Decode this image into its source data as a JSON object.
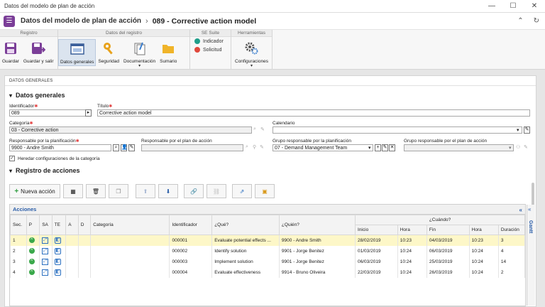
{
  "window": {
    "title": "Datos del modelo de plan de acción",
    "controls": [
      "—",
      "☐",
      "✕"
    ]
  },
  "header": {
    "app_title": "Datos del modelo de plan de acción",
    "separator": "›",
    "record": "089 - Corrective action model"
  },
  "ribbon": {
    "groups": [
      {
        "title": "Registro",
        "buttons": [
          "Guardar",
          "Guardar y salir"
        ]
      },
      {
        "title": "Datos del registro",
        "buttons": [
          "Datos generales",
          "Seguridad",
          "Documentación",
          "Sumario"
        ]
      },
      {
        "title": "SE Suite",
        "buttons": [
          "Indicador",
          "Solicitud"
        ]
      },
      {
        "title": "Herramientas",
        "buttons": [
          "Configuraciones"
        ]
      }
    ]
  },
  "panel": {
    "header": "DATOS GENERALES",
    "section_general": "Datos generales",
    "fields": {
      "identificador": {
        "label": "Identificador",
        "value": "089"
      },
      "titulo": {
        "label": "Título",
        "value": "Corrective action model"
      },
      "categoria": {
        "label": "Categoría",
        "value": "03 - Corrective action"
      },
      "calendario": {
        "label": "Calendario",
        "value": ""
      },
      "resp_planificacion": {
        "label": "Responsable por la planificación",
        "value": "9900 - Andre Smith"
      },
      "resp_plan_accion": {
        "label": "Responsable por el plan de acción",
        "value": ""
      },
      "grupo_planificacion": {
        "label": "Grupo responsable por la planificación",
        "value": "07 - Demand Management Team"
      },
      "grupo_plan_accion": {
        "label": "Grupo responsable por el plan de acción",
        "value": ""
      }
    },
    "inherit_label": "Heredar configuraciones de la categoría",
    "section_actions": "Registro de acciones",
    "new_action": "Nueva acción"
  },
  "grid": {
    "title": "Acciones",
    "gantt_label": "Gantt",
    "headers": {
      "sec": "Sec.",
      "p": "P",
      "sa": "SA",
      "te": "TE",
      "a": "A",
      "d": "D",
      "categoria": "Categoría",
      "identificador": "Identificador",
      "que": "¿Qué?",
      "quien": "¿Quién?",
      "cuando": "¿Cuándo?",
      "inicio": "Inicio",
      "hora": "Hora",
      "fin": "Fin",
      "hora2": "Hora",
      "duracion": "Duración"
    },
    "rows": [
      {
        "sec": "1",
        "id": "000001",
        "que": "Evaluate potential effects ...",
        "quien": "9900 - Andre Smith",
        "inicio": "28/02/2019",
        "hora": "10:23",
        "fin": "04/03/2019",
        "hora2": "10:23",
        "duracion": "3"
      },
      {
        "sec": "2",
        "id": "000002",
        "que": "Identify solution",
        "quien": "9901 - Jorge Benitez",
        "inicio": "01/03/2019",
        "hora": "10:24",
        "fin": "06/03/2019",
        "hora2": "10:24",
        "duracion": "4"
      },
      {
        "sec": "3",
        "id": "000003",
        "que": "Implement solution",
        "quien": "9901 - Jorge Benitez",
        "inicio": "06/03/2019",
        "hora": "10:24",
        "fin": "25/03/2019",
        "hora2": "10:24",
        "duracion": "14"
      },
      {
        "sec": "4",
        "id": "000004",
        "que": "Evaluate effectiveness",
        "quien": "9914 - Bruno Oliveira",
        "inicio": "22/03/2019",
        "hora": "10:24",
        "fin": "26/03/2019",
        "hora2": "10:24",
        "duracion": "2"
      }
    ]
  }
}
